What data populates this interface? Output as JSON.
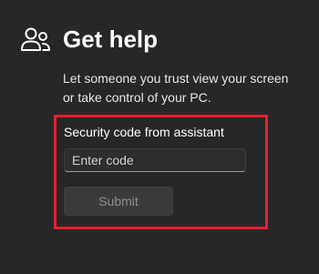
{
  "header": {
    "icon": "people-icon",
    "title": "Get help"
  },
  "description": {
    "line1": "Let someone you trust view your screen",
    "line2": "or take control of your PC."
  },
  "form": {
    "label": "Security code from assistant",
    "input_placeholder": "Enter code",
    "input_value": "",
    "submit_label": "Submit",
    "submit_enabled": false
  },
  "colors": {
    "background": "#272727",
    "highlight": "#e51f2e",
    "input_background": "#2d2d2d",
    "button_background": "#3a3a3a",
    "disabled_text": "#8f8f8f"
  }
}
